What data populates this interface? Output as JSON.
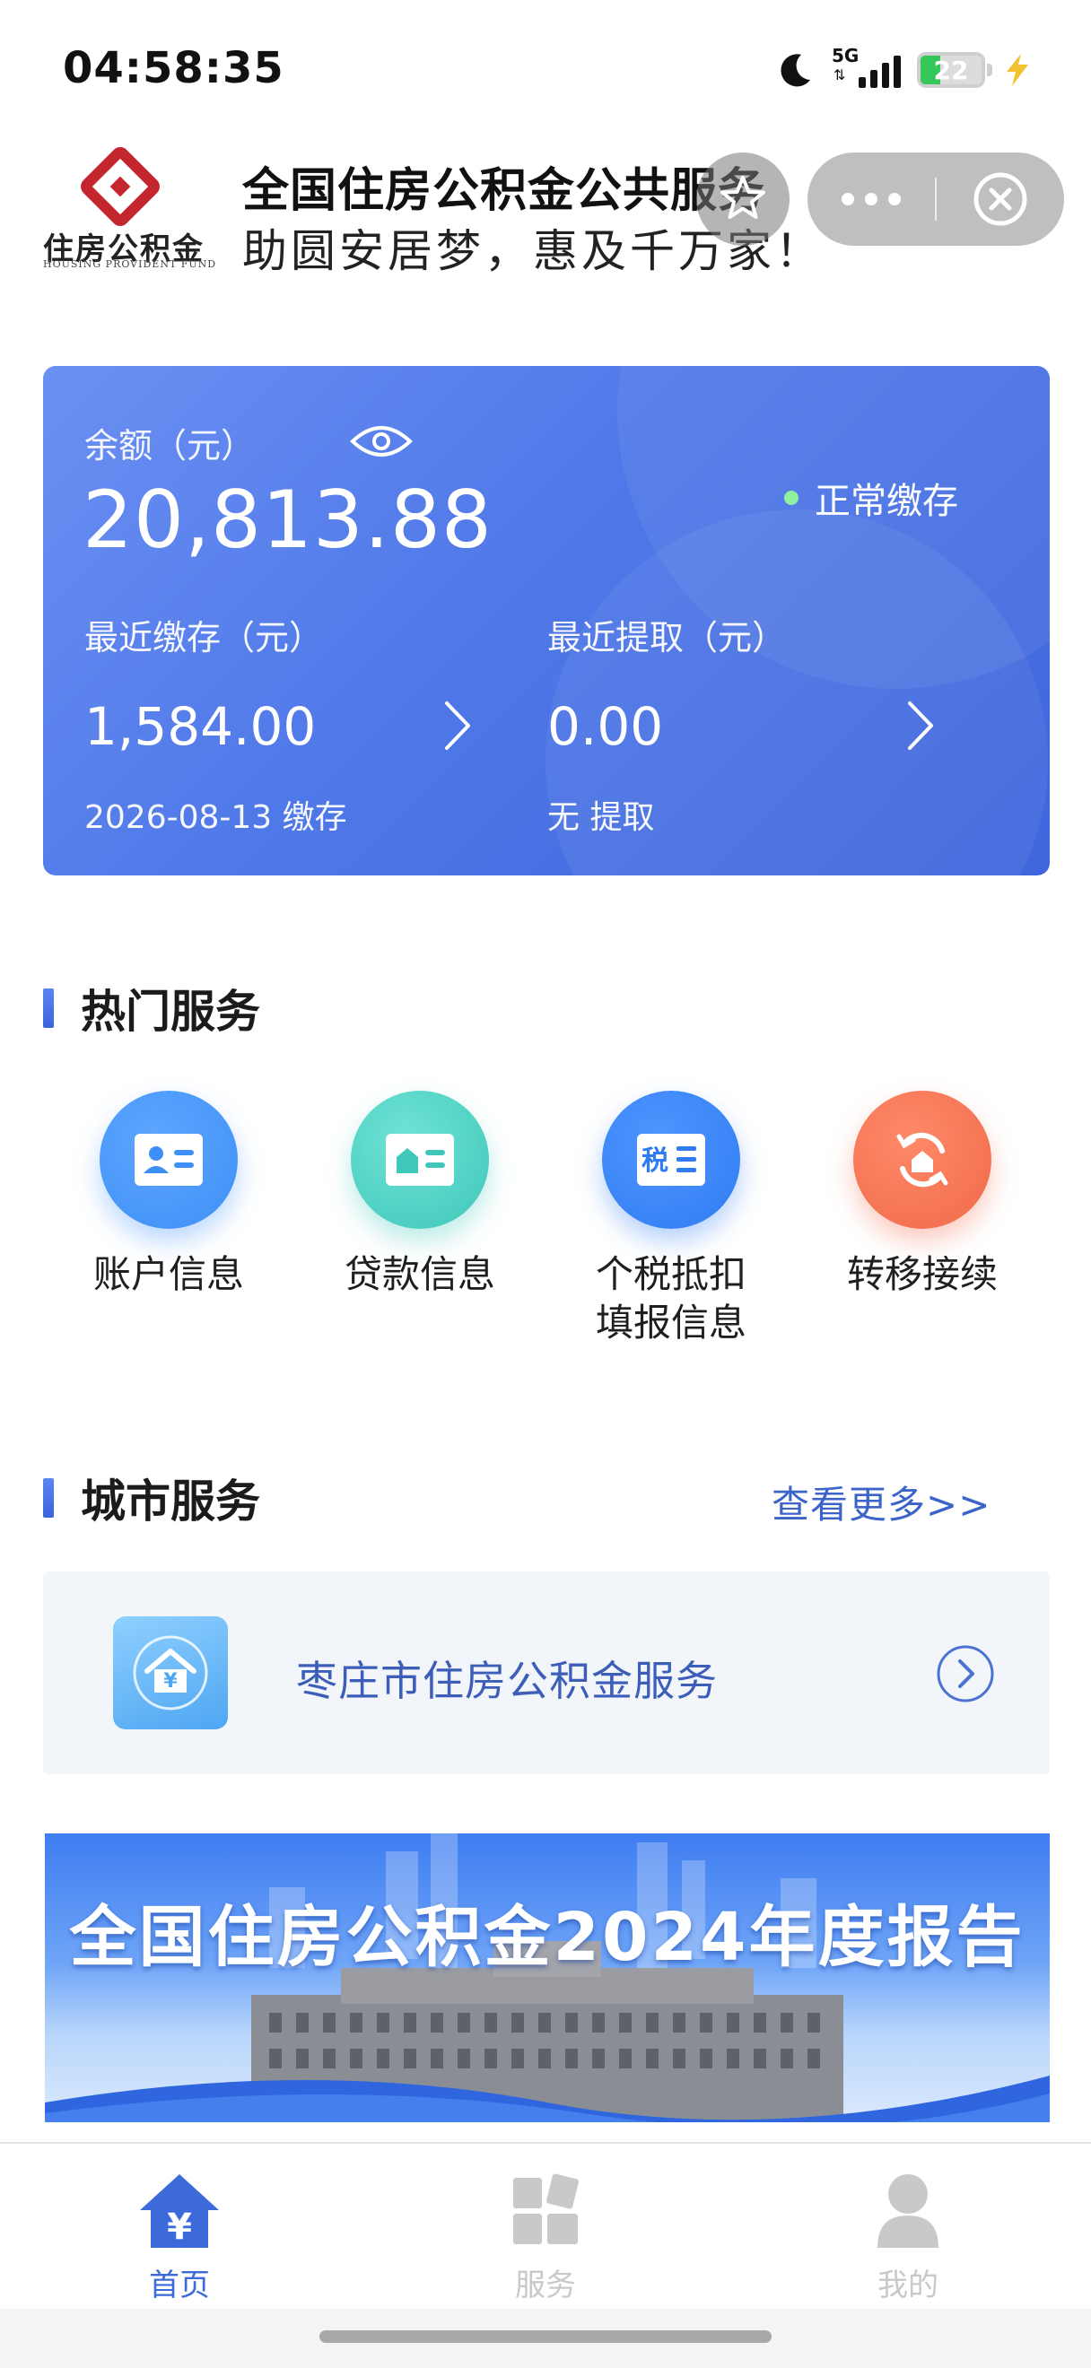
{
  "status_bar": {
    "time": "04:58:35",
    "network": "5G",
    "battery_level": "22",
    "icons": [
      "moon-icon",
      "signal-icon",
      "battery-icon",
      "charging-bolt-icon"
    ]
  },
  "header": {
    "logo_cn": "住房公积金",
    "logo_en": "HOUSING PROVIDENT FUND",
    "title": "全国住房公积金公共服务",
    "slogan": "助圆安居梦，惠及千万家！"
  },
  "balance_card": {
    "balance_label": "余额（元）",
    "balance_value": "20,813.88",
    "status": "正常缴存",
    "recent_deposit_label": "最近缴存（元）",
    "recent_deposit_value": "1,584.00",
    "recent_deposit_date": "2026-08-13 缴存",
    "recent_withdraw_label": "最近提取（元）",
    "recent_withdraw_value": "0.00",
    "recent_withdraw_note": "无 提取"
  },
  "hot_services": {
    "title": "热门服务",
    "items": [
      {
        "label": "账户信息",
        "color": "#3d8ff5",
        "icon": "account-card-icon"
      },
      {
        "label": "贷款信息",
        "color": "#46d2c4",
        "icon": "loan-card-icon"
      },
      {
        "label": "个税抵扣\n填报信息",
        "color": "#2f7cf2",
        "icon": "tax-icon",
        "icon_text": "税"
      },
      {
        "label": "转移接续",
        "color": "#f0694a",
        "icon": "transfer-icon"
      }
    ]
  },
  "city_services": {
    "title": "城市服务",
    "more_label": "查看更多>>",
    "item_label": "枣庄市住房公积金服务"
  },
  "banner": {
    "title": "全国住房公积金2024年度报告"
  },
  "tabbar": {
    "items": [
      {
        "label": "首页",
        "active": true
      },
      {
        "label": "服务",
        "active": false
      },
      {
        "label": "我的",
        "active": false
      }
    ],
    "active_color": "#3d6ad9"
  }
}
